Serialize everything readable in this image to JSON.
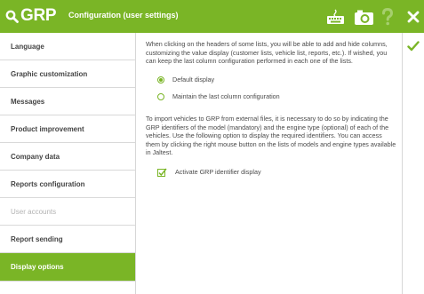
{
  "header": {
    "logo_text": "GRP",
    "title": "Configuration (user settings)",
    "icons": [
      "keyboard-icon",
      "camera-icon",
      "help-icon",
      "close-icon"
    ],
    "accent_color": "#7ab526"
  },
  "sidebar": {
    "items": [
      {
        "label": "Language",
        "state": "normal"
      },
      {
        "label": "Graphic customization",
        "state": "normal"
      },
      {
        "label": "Messages",
        "state": "normal"
      },
      {
        "label": "Product improvement",
        "state": "normal"
      },
      {
        "label": "Company data",
        "state": "normal"
      },
      {
        "label": "Reports configuration",
        "state": "normal"
      },
      {
        "label": "User accounts",
        "state": "disabled"
      },
      {
        "label": "Report sending",
        "state": "normal"
      },
      {
        "label": "Display options",
        "state": "active"
      }
    ]
  },
  "main": {
    "intro_text": "When clicking on the headers of some lists, you will be able to add and hide columns, customizing the value display (customer lists, vehicle list, reports, etc.). If wished, you can keep the last column configuration performed in each one of the lists.",
    "column_options": [
      {
        "label": "Default display",
        "selected": true
      },
      {
        "label": "Maintain the last column configuration",
        "selected": false
      }
    ],
    "import_text": "To import vehicles to GRP from external files, it is necessary to do so by indicating the GRP identifiers of the model (mandatory) and the engine type (optional) of each of the vehicles. Use the following option to display the required identifiers. You can access them by clicking the right mouse button on the lists of models and engine types available in Jaltest.",
    "identifier_checkbox": {
      "label": "Activate GRP identifier display",
      "checked": true
    }
  },
  "actions": {
    "confirm_icon": "checkmark-icon"
  }
}
